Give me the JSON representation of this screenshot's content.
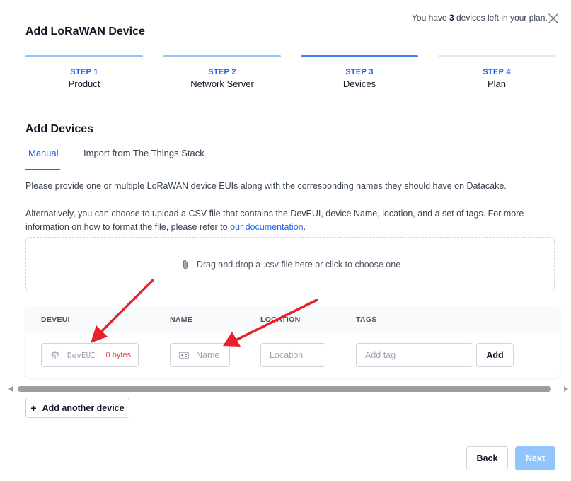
{
  "header": {
    "plan_prefix": "You have",
    "devices_left": "3",
    "plan_suffix": "devices left in your plan.",
    "title": "Add LoRaWAN Device"
  },
  "steps": [
    {
      "number": "STEP 1",
      "name": "Product",
      "state": "done"
    },
    {
      "number": "STEP 2",
      "name": "Network Server",
      "state": "done"
    },
    {
      "number": "STEP 3",
      "name": "Devices",
      "state": "active"
    },
    {
      "number": "STEP 4",
      "name": "Plan",
      "state": "upcoming"
    }
  ],
  "section": {
    "title": "Add Devices",
    "tabs": [
      "Manual",
      "Import from The Things Stack"
    ],
    "active_tab": "Manual"
  },
  "description": {
    "line1": "Please provide one or multiple LoRaWAN device EUIs along with the corresponding names they should have on Datacake.",
    "line2": "Alternatively, you can choose to upload a CSV file that contains the DevEUI, device Name, location, and a set of tags. For more information on how to format the file, please refer to",
    "link": "our documentation",
    "line2_end": "."
  },
  "dropzone": {
    "text": "Drag and drop a .csv file here or click to choose one"
  },
  "table": {
    "columns": [
      "DEVEUI",
      "NAME",
      "LOCATION",
      "TAGS"
    ],
    "row": {
      "deveui_placeholder": "DevEUI",
      "deveui_bytes": "0 bytes",
      "name_placeholder": "Name",
      "location_placeholder": "Location",
      "tag_placeholder": "Add tag",
      "add_tag_label": "Add"
    }
  },
  "actions": {
    "add_another": "Add another device",
    "back": "Back",
    "next": "Next"
  },
  "colors": {
    "accent": "#2563eb",
    "step_done": "#93c5fd",
    "step_active": "#3b82f6",
    "error": "#ef4444",
    "annotation_arrow": "#e8212a"
  }
}
